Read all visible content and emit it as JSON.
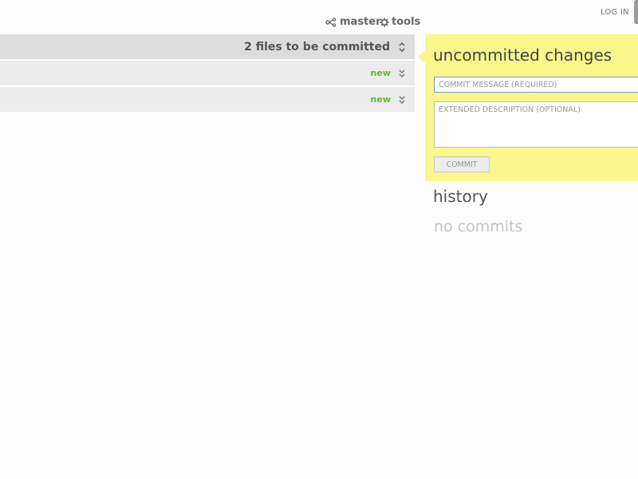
{
  "toolbar": {
    "branch_label": "master",
    "tools_label": "tools",
    "login_label": "LOG IN",
    "branch_icon": "branch-icon",
    "tools_icon": "gear-icon"
  },
  "files": {
    "summary": "2 files to be committed",
    "rows": [
      {
        "status": "new"
      },
      {
        "status": "new"
      }
    ]
  },
  "commit": {
    "title": "uncommitted changes",
    "message_placeholder": "COMMIT MESSAGE (REQUIRED)",
    "message_value": "",
    "description_placeholder": "EXTENDED DESCRIPTION (OPTIONAL)",
    "description_value": "",
    "button_label": "COMMIT"
  },
  "history": {
    "title": "history",
    "empty_text": "no commits"
  },
  "colors": {
    "commit_panel_bg": "#fbf68c",
    "status_new": "#5cbf2a",
    "header_bg": "#dddddd",
    "row_bg": "#ebebeb"
  }
}
